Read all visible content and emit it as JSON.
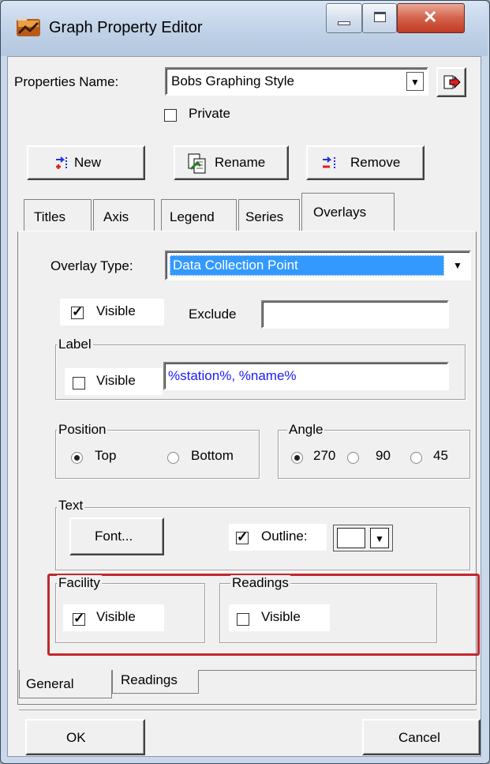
{
  "window": {
    "title": "Graph Property Editor",
    "minimize_icon": "minimize-icon",
    "maximize_icon": "maximize-icon",
    "close_icon": "close-icon"
  },
  "properties": {
    "name_label": "Properties Name:",
    "name_value": "Bobs Graphing Style",
    "private_label": "Private",
    "private_checked": false
  },
  "toolbar": {
    "new_label": "New",
    "rename_label": "Rename",
    "remove_label": "Remove"
  },
  "tabs": [
    "Titles",
    "Axis",
    "Legend",
    "Series",
    "Overlays"
  ],
  "active_tab": "Overlays",
  "overlays": {
    "type_label": "Overlay Type:",
    "type_value": "Data Collection Point",
    "visible_label": "Visible",
    "visible_checked": true,
    "exclude_label": "Exclude",
    "exclude_value": "",
    "label_group": {
      "title": "Label",
      "visible_label": "Visible",
      "visible_checked": false,
      "format_value": "%station%, %name%"
    },
    "position_group": {
      "title": "Position",
      "options": [
        "Top",
        "Bottom"
      ],
      "selected": "Top"
    },
    "angle_group": {
      "title": "Angle",
      "options": [
        "270",
        "90",
        "45"
      ],
      "selected": "270"
    },
    "text_group": {
      "title": "Text",
      "font_button": "Font...",
      "outline_label": "Outline:",
      "outline_checked": true,
      "outline_color": "#ffffff"
    },
    "facility_group": {
      "title": "Facility",
      "visible_label": "Visible",
      "visible_checked": true
    },
    "readings_group": {
      "title": "Readings",
      "visible_label": "Visible",
      "visible_checked": false
    },
    "highlight_color": "#c0282d"
  },
  "sub_tabs": [
    "General",
    "Readings"
  ],
  "active_sub_tab": "General",
  "footer": {
    "ok_label": "OK",
    "cancel_label": "Cancel"
  },
  "colors": {
    "selection": "#3399ff",
    "link_blue": "#1a1aff"
  }
}
